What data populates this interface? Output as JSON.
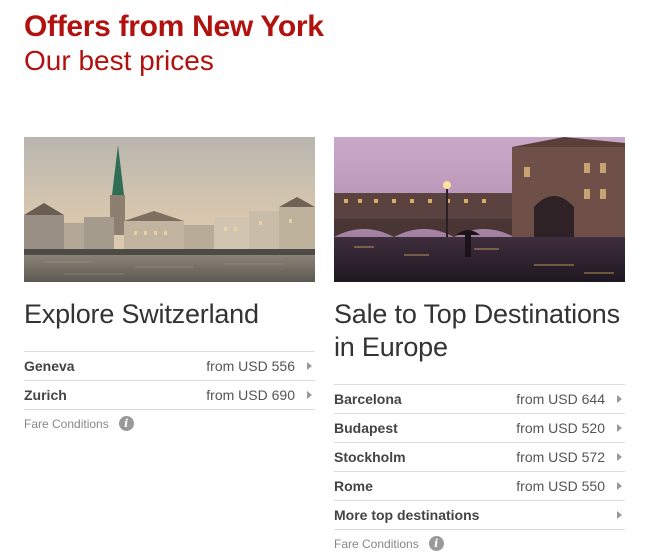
{
  "header": {
    "title": "Offers from New York",
    "subtitle": "Our best prices"
  },
  "cards": [
    {
      "title": "Explore Switzerland",
      "image_alt": "city-skyline-by-water",
      "rows": [
        {
          "destination": "Geneva",
          "price": "from USD 556"
        },
        {
          "destination": "Zurich",
          "price": "from USD 690"
        }
      ],
      "fare_conditions": "Fare Conditions"
    },
    {
      "title": "Sale to Top Destinations in Europe",
      "image_alt": "bridge-over-river-at-dusk",
      "rows": [
        {
          "destination": "Barcelona",
          "price": "from USD 644"
        },
        {
          "destination": "Budapest",
          "price": "from USD 520"
        },
        {
          "destination": "Stockholm",
          "price": "from USD 572"
        },
        {
          "destination": "Rome",
          "price": "from USD 550"
        },
        {
          "destination": "More top destinations",
          "price": ""
        }
      ],
      "fare_conditions": "Fare Conditions"
    }
  ],
  "colors": {
    "brand": "#b2120f",
    "text": "#333333",
    "divider": "#dddddd"
  },
  "icons": {
    "row_arrow": "chevron-right-icon",
    "info": "info-icon"
  }
}
